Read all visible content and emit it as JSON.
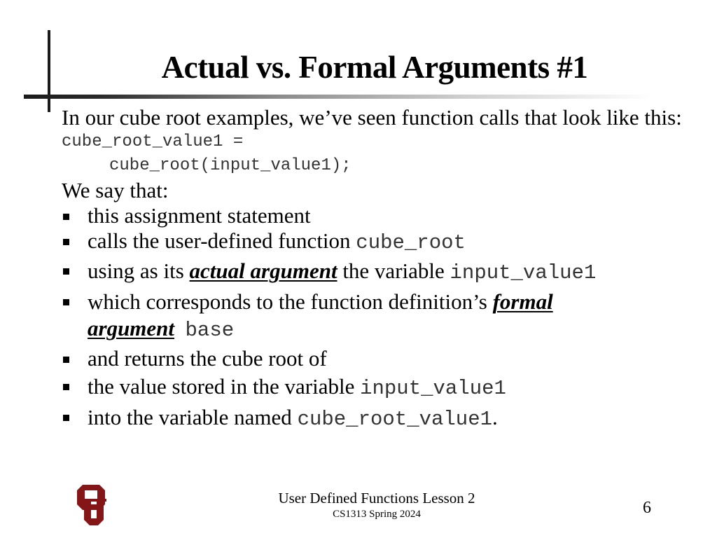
{
  "slide": {
    "title": "Actual vs. Formal Arguments #1",
    "intro": "In our cube root examples, we’ve seen function calls that look like this:",
    "code": {
      "line1": "cube_root_value1 =",
      "line2": "cube_root(input_value1);"
    },
    "lead_in": "We say that:",
    "bullets": [
      {
        "text": "this assignment statement"
      },
      {
        "text": "calls the user-defined function ",
        "code": "cube_root"
      },
      {
        "before": "using as its ",
        "term": "actual argument",
        "after": " the variable ",
        "code": "input_value1"
      },
      {
        "before": "which corresponds to the function definition’s ",
        "term1": "formal",
        "term2": "argument",
        "code": "base"
      },
      {
        "text": "and returns the cube root of"
      },
      {
        "text": "the value stored in the variable ",
        "code": "input_value1"
      },
      {
        "text": "into the variable named ",
        "code": "cube_root_value1",
        "after": "."
      }
    ]
  },
  "footer": {
    "title": "User Defined Functions Lesson 2",
    "subtitle": "CS1313 Spring 2024",
    "page_number": "6",
    "logo": "ou-logo-icon"
  },
  "colors": {
    "logo_crimson": "#841617",
    "text": "#000000",
    "code_text": "#333333"
  }
}
